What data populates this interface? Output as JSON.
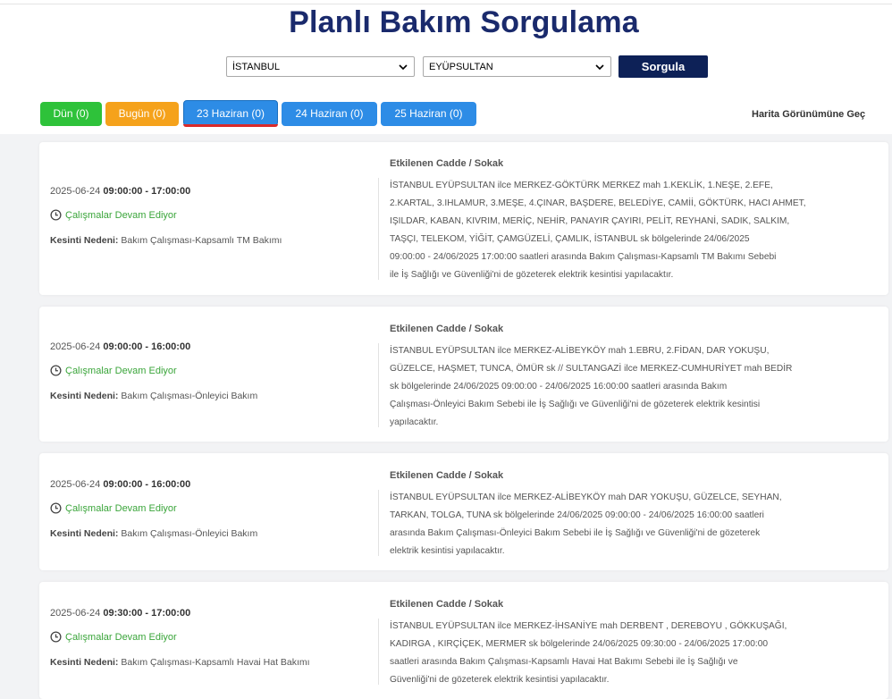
{
  "page": {
    "title": "Planlı Bakım Sorgulama"
  },
  "filters": {
    "city": "İSTANBUL",
    "district": "EYÜPSULTAN",
    "query_button": "Sorgula"
  },
  "tabs": [
    {
      "label": "Dün (0)",
      "color": "#2ec23a"
    },
    {
      "label": "Bugün (0)",
      "color": "#f5a21b"
    },
    {
      "label": "23 Haziran (0)",
      "color": "#2d8ce6"
    },
    {
      "label": "24 Haziran (0)",
      "color": "#2d8ce6"
    },
    {
      "label": "25 Haziran (0)",
      "color": "#2d8ce6"
    }
  ],
  "map_link": "Harita Görünümüne Geç",
  "labels": {
    "affected": "Etkilenen Cadde / Sokak",
    "reason_prefix": "Kesinti Nedeni:"
  },
  "outages": [
    {
      "date": "2025-06-24",
      "time": "09:00:00 - 17:00:00",
      "status": "Çalışmalar Devam Ediyor",
      "reason": "Bakım Çalışması-Kapsamlı TM Bakımı",
      "lines": [
        "İSTANBUL EYÜPSULTAN ilce MERKEZ-GÖKTÜRK MERKEZ mah 1.KEKLİK, 1.NEŞE, 2.EFE,",
        "2.KARTAL, 3.IHLAMUR, 3.MEŞE, 4.ÇINAR, BAŞDERE, BELEDİYE, CAMİİ, GÖKTÜRK, HACI AHMET,",
        "IŞILDAR, KABAN, KIVRIM, MERİÇ, NEHİR, PANAYIR ÇAYIRI, PELİT, REYHANİ, SADIK, SALKIM,",
        "TAŞÇI, TELEKOM, YİĞİT, ÇAMGÜZELİ, ÇAMLIK, İSTANBUL sk bölgelerinde 24/06/2025",
        "09:00:00 - 24/06/2025 17:00:00 saatleri arasında Bakım Çalışması-Kapsamlı TM Bakımı Sebebi",
        "ile İş Sağlığı ve Güvenliği'ni de gözeterek elektrik kesintisi yapılacaktır."
      ]
    },
    {
      "date": "2025-06-24",
      "time": "09:00:00 - 16:00:00",
      "status": "Çalışmalar Devam Ediyor",
      "reason": "Bakım Çalışması-Önleyici Bakım",
      "lines": [
        "İSTANBUL EYÜPSULTAN ilce MERKEZ-ALİBEYKÖY mah 1.EBRU, 2.FİDAN, DAR YOKUŞU,",
        "GÜZELCE, HAŞMET, TUNCA, ÖMÜR sk // SULTANGAZİ ilce MERKEZ-CUMHURİYET mah BEDİR",
        "sk bölgelerinde 24/06/2025 09:00:00 - 24/06/2025 16:00:00 saatleri arasında Bakım",
        "Çalışması-Önleyici Bakım Sebebi ile İş Sağlığı ve Güvenliği'ni de gözeterek elektrik kesintisi",
        "yapılacaktır."
      ]
    },
    {
      "date": "2025-06-24",
      "time": "09:00:00 - 16:00:00",
      "status": "Çalışmalar Devam Ediyor",
      "reason": "Bakım Çalışması-Önleyici Bakım",
      "lines": [
        "İSTANBUL EYÜPSULTAN ilce MERKEZ-ALİBEYKÖY mah DAR YOKUŞU, GÜZELCE, SEYHAN,",
        "TARKAN, TOLGA, TUNA sk bölgelerinde 24/06/2025 09:00:00 - 24/06/2025 16:00:00 saatleri",
        "arasında Bakım Çalışması-Önleyici Bakım Sebebi ile İş Sağlığı ve Güvenliği'ni de gözeterek",
        "elektrik kesintisi yapılacaktır."
      ]
    },
    {
      "date": "2025-06-24",
      "time": "09:30:00 - 17:00:00",
      "status": "Çalışmalar Devam Ediyor",
      "reason": "Bakım Çalışması-Kapsamlı Havai Hat Bakımı",
      "lines": [
        "İSTANBUL EYÜPSULTAN ilce MERKEZ-İHSANİYE mah DERBENT , DEREBOYU , GÖKKUŞAĞI,",
        "KADIRGA , KIRÇİÇEK, MERMER sk bölgelerinde 24/06/2025 09:30:00 - 24/06/2025 17:00:00",
        "saatleri arasında Bakım Çalışması-Kapsamlı Havai Hat Bakımı Sebebi ile İş Sağlığı ve",
        "Güvenliği'ni de gözeterek elektrik kesintisi yapılacaktır."
      ]
    }
  ]
}
